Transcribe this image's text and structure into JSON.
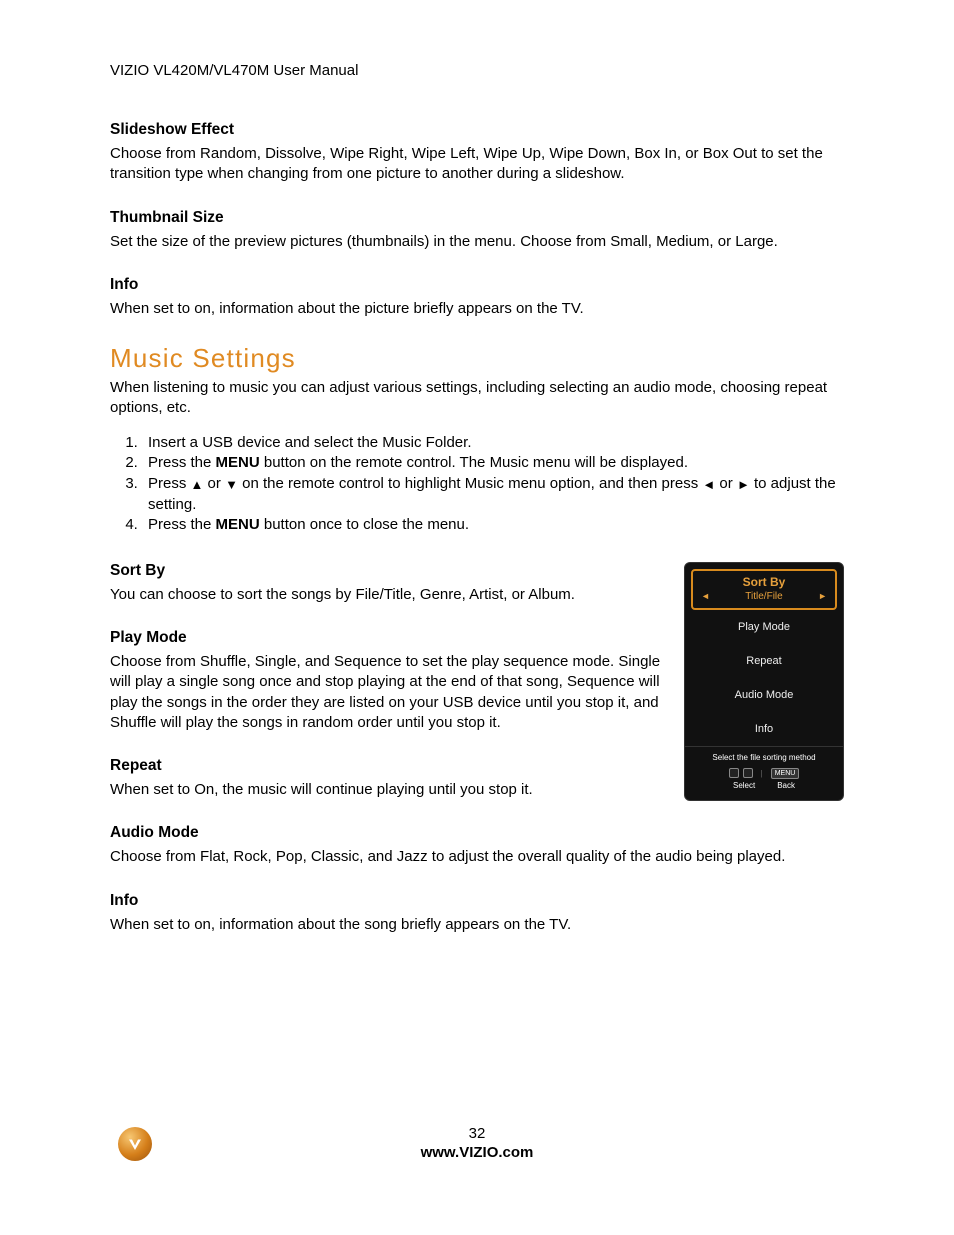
{
  "header": "VIZIO VL420M/VL470M User Manual",
  "slideshow": {
    "heading": "Slideshow Effect",
    "body": "Choose from Random, Dissolve, Wipe Right, Wipe Left, Wipe Up, Wipe Down, Box In, or Box Out to set the transition type when changing from one picture to another during a slideshow."
  },
  "thumbnail": {
    "heading": "Thumbnail Size",
    "body": "Set the size of the preview pictures (thumbnails) in the menu. Choose from Small, Medium, or Large."
  },
  "info1": {
    "heading": "Info",
    "body": "When set to on, information about the picture briefly appears on the TV."
  },
  "music": {
    "heading": "Music Settings",
    "intro": "When listening to music you can adjust various settings, including selecting an audio mode, choosing repeat options, etc.",
    "step1": "Insert a USB device and select the Music Folder.",
    "step2a": "Press the ",
    "step2b": "MENU",
    "step2c": " button on the remote control. The Music menu will be displayed.",
    "step3a": "Press ",
    "step3b": " or ",
    "step3c": " on the remote control to highlight Music menu option, and then press ",
    "step3d": " or ",
    "step3e": " to adjust the setting.",
    "step4a": "Press the ",
    "step4b": "MENU",
    "step4c": " button once to close the menu."
  },
  "sortby": {
    "heading": "Sort By",
    "body": "You can choose to sort the songs by File/Title, Genre, Artist, or Album."
  },
  "playmode": {
    "heading": "Play Mode",
    "body": "Choose from Shuffle, Single, and Sequence to set the play sequence mode. Single will play a single song once and stop playing at the end of that song, Sequence will play the songs in the order they are listed on your USB device until you stop it, and Shuffle will play the songs in random order until you stop it."
  },
  "repeat": {
    "heading": "Repeat",
    "body": "When set to On, the music will continue playing until you stop it."
  },
  "audiomode": {
    "heading": "Audio Mode",
    "body": "Choose from Flat, Rock, Pop, Classic, and Jazz to adjust the overall quality of the audio being played."
  },
  "info2": {
    "heading": "Info",
    "body": "When set to on, information about the song briefly appears on the TV."
  },
  "osd": {
    "title": "Sort By",
    "subtitle": "Title/File",
    "items": {
      "0": "Play Mode",
      "1": "Repeat",
      "2": "Audio Mode",
      "3": "Info"
    },
    "hint": "Select the file sorting method",
    "select_label": "Select",
    "back_label": "Back",
    "menu_btn": "MENU"
  },
  "footer": {
    "page": "32",
    "url": "www.VIZIO.com"
  }
}
